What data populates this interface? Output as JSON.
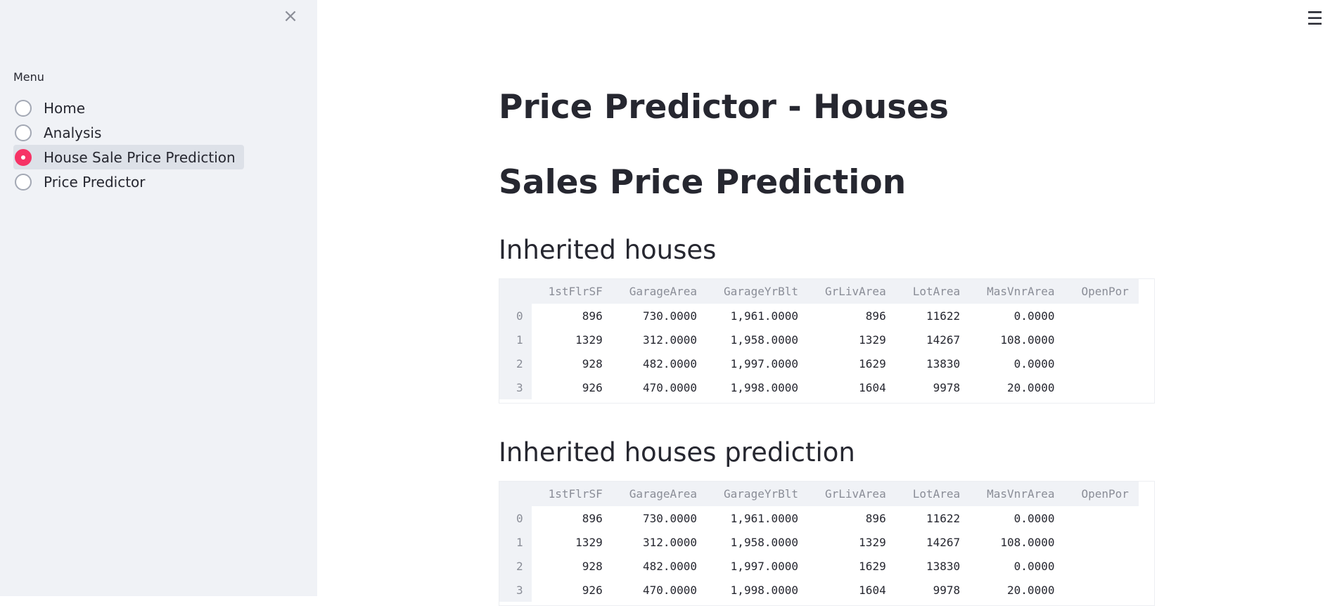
{
  "sidebar": {
    "close_icon": "×",
    "menu_label": "Menu",
    "items": [
      {
        "label": "Home",
        "selected": false
      },
      {
        "label": "Analysis",
        "selected": false
      },
      {
        "label": "House Sale Price Prediction",
        "selected": true
      },
      {
        "label": "Price Predictor",
        "selected": false
      }
    ]
  },
  "header": {
    "hamburger_icon": "☰"
  },
  "main": {
    "title": "Price Predictor - Houses",
    "subtitle": "Sales Price Prediction",
    "section1_heading": "Inherited houses",
    "section2_heading": "Inherited houses prediction",
    "table_columns": [
      "1stFlrSF",
      "GarageArea",
      "GarageYrBlt",
      "GrLivArea",
      "LotArea",
      "MasVnrArea",
      "OpenPor"
    ],
    "table_rows": [
      {
        "index": "0",
        "cells": [
          "896",
          "730.0000",
          "1,961.0000",
          "896",
          "11622",
          "0.0000",
          ""
        ]
      },
      {
        "index": "1",
        "cells": [
          "1329",
          "312.0000",
          "1,958.0000",
          "1329",
          "14267",
          "108.0000",
          ""
        ]
      },
      {
        "index": "2",
        "cells": [
          "928",
          "482.0000",
          "1,997.0000",
          "1629",
          "13830",
          "0.0000",
          ""
        ]
      },
      {
        "index": "3",
        "cells": [
          "926",
          "470.0000",
          "1,998.0000",
          "1604",
          "9978",
          "20.0000",
          ""
        ]
      }
    ],
    "prediction_table_rows": [
      {
        "index": "0",
        "cells": [
          "896",
          "730.0000",
          "1,961.0000",
          "896",
          "11622",
          "0.0000",
          ""
        ]
      },
      {
        "index": "1",
        "cells": [
          "1329",
          "312.0000",
          "1,958.0000",
          "1329",
          "14267",
          "108.0000",
          ""
        ]
      },
      {
        "index": "2",
        "cells": [
          "928",
          "482.0000",
          "1,997.0000",
          "1629",
          "13830",
          "0.0000",
          ""
        ]
      },
      {
        "index": "3",
        "cells": [
          "926",
          "470.0000",
          "1,998.0000",
          "1604",
          "9978",
          "20.0000",
          ""
        ]
      }
    ]
  },
  "colors": {
    "accent": "#f63366",
    "sidebar_bg": "#f0f2f6",
    "text": "#262730"
  }
}
